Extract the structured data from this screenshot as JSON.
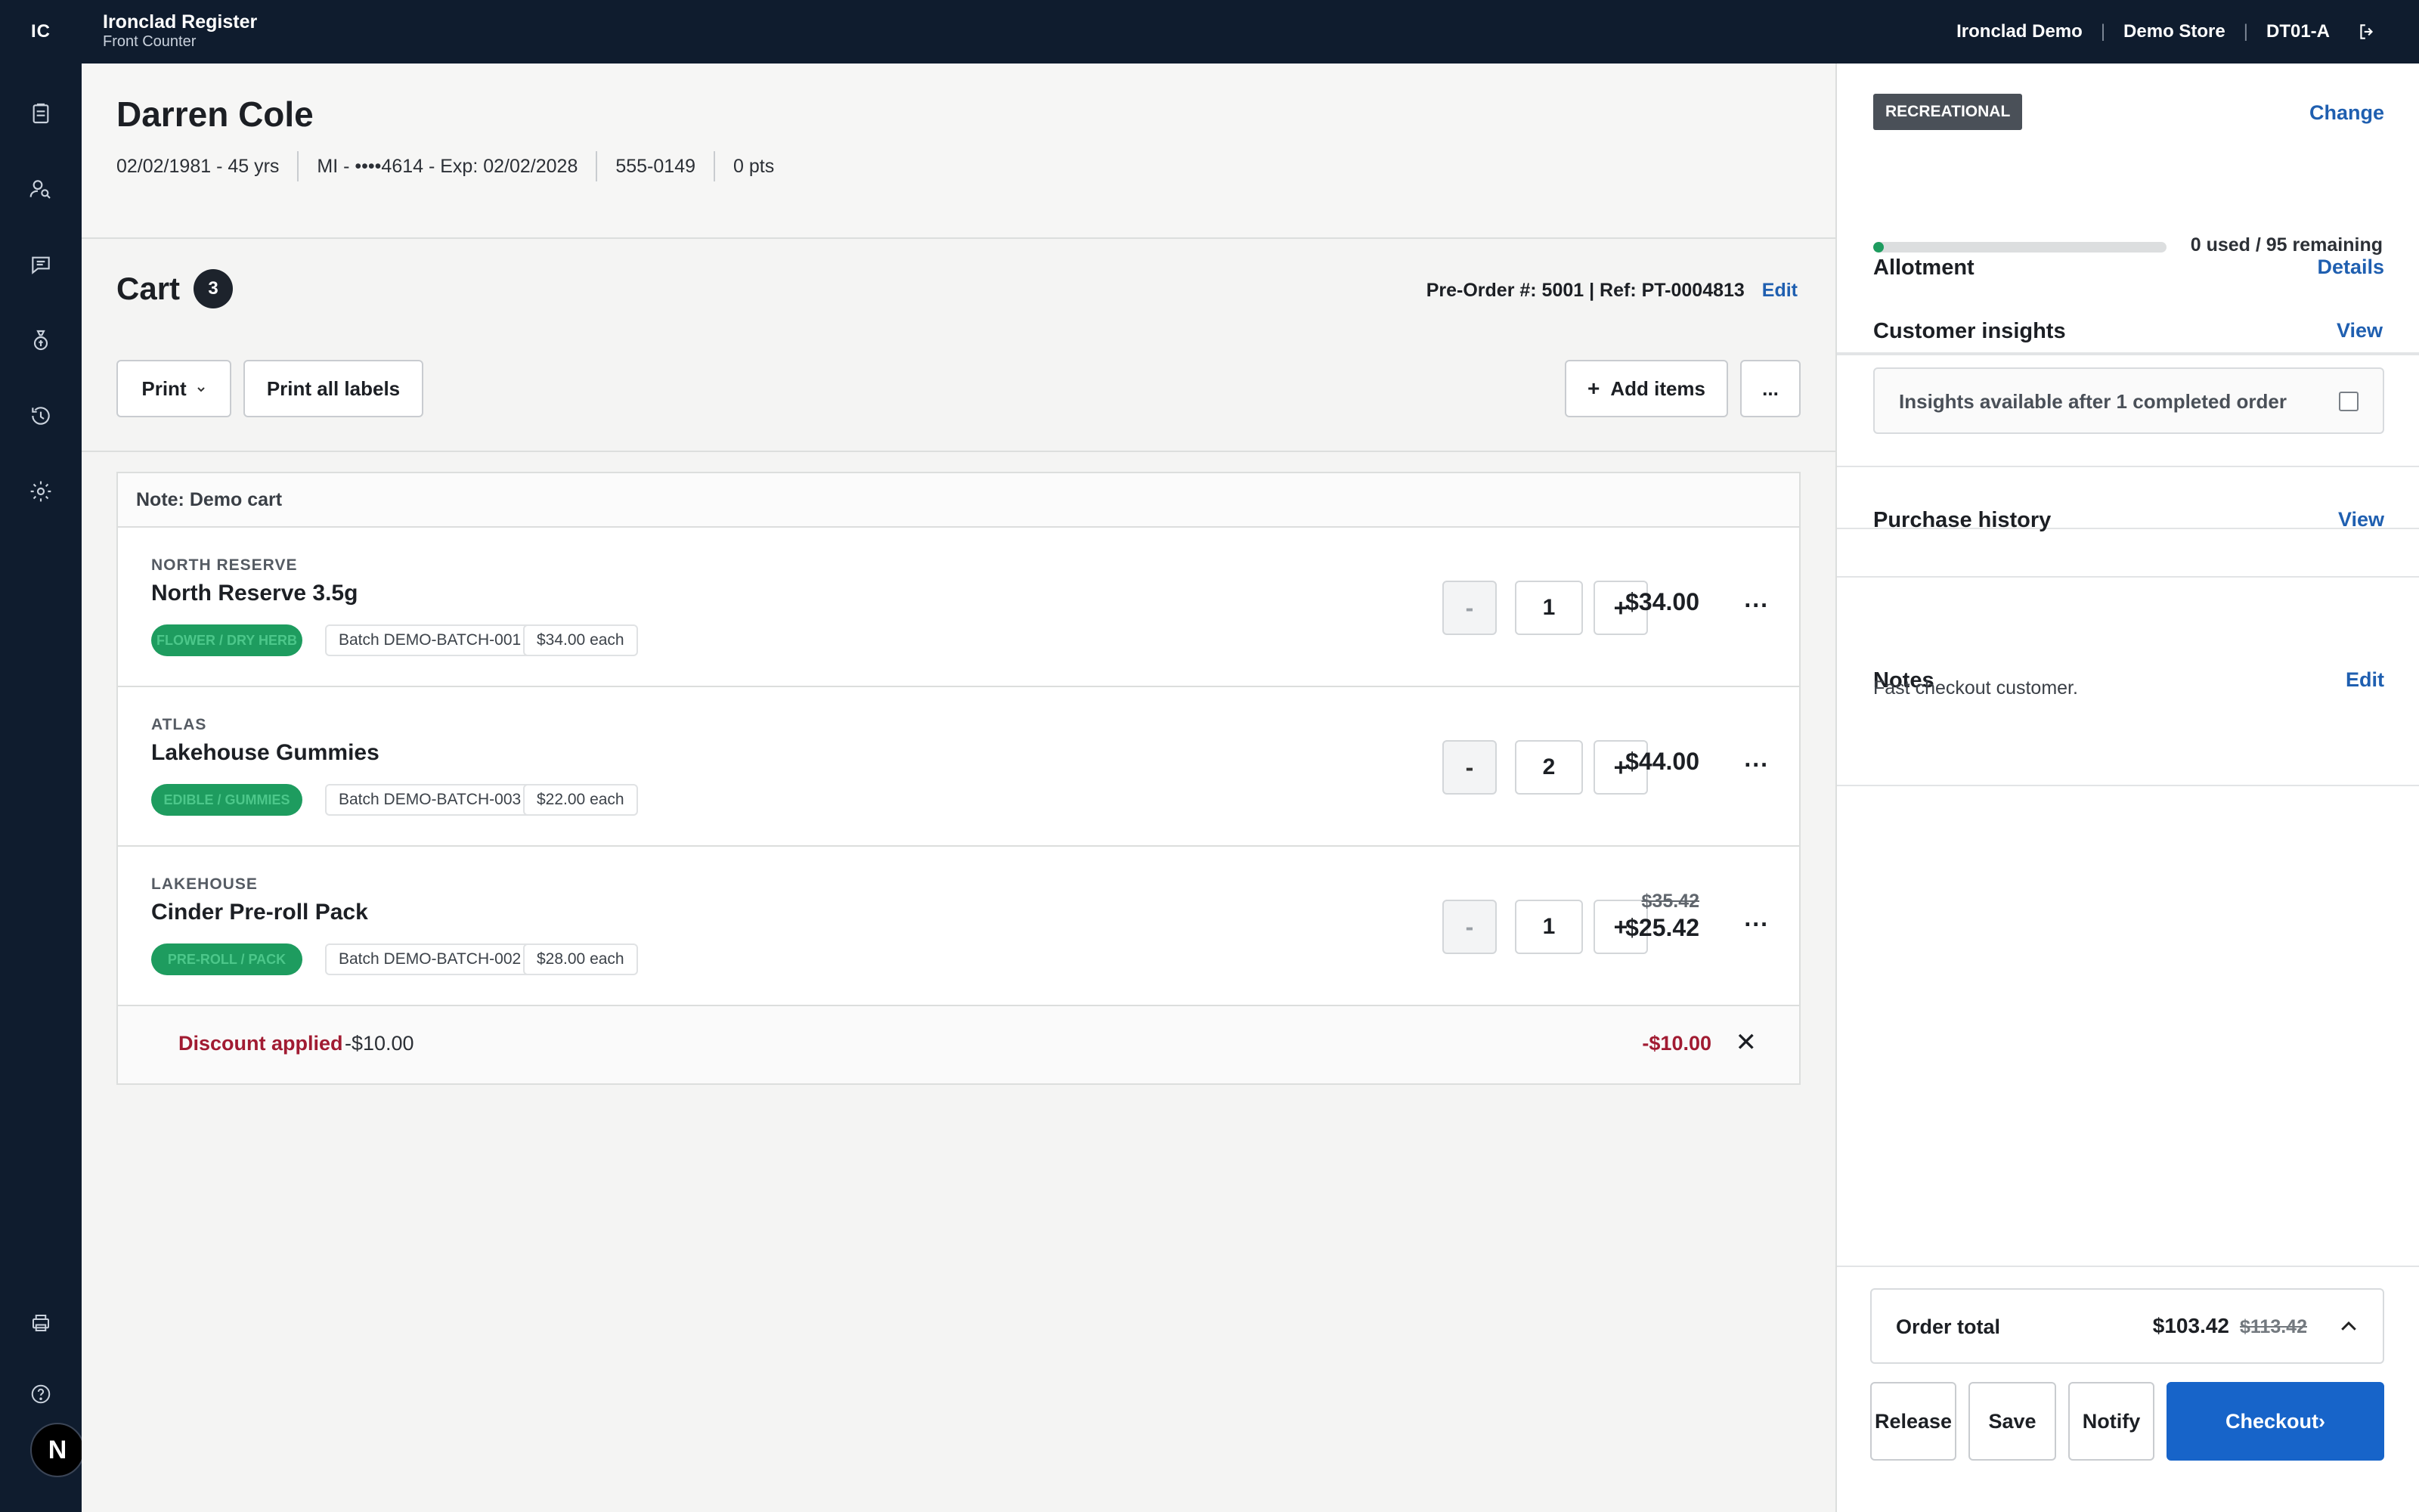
{
  "topbar": {
    "logo": "IC",
    "title": "Ironclad Register",
    "subtitle": "Front Counter",
    "org": "Ironclad Demo",
    "store": "Demo Store",
    "terminal": "DT01-A"
  },
  "rail": {
    "icons": [
      "orders-icon",
      "customer-search-icon",
      "messages-icon",
      "cash-icon",
      "history-icon",
      "settings-icon",
      "printer-icon",
      "help-icon"
    ],
    "badge": "N"
  },
  "customer": {
    "name": "Darren Cole",
    "dob": "02/02/1981 - 45 yrs",
    "id": "MI - ••••4614 - Exp: 02/02/2028",
    "phone": "555-0149",
    "points": "0 pts"
  },
  "cart": {
    "title": "Cart",
    "count": "3",
    "preorder": "Pre-Order #: 5001 | Ref: PT-0004813",
    "edit_label": "Edit",
    "print_label": "Print",
    "print_all_label": "Print all labels",
    "add_items_label": "Add items",
    "more_label": "...",
    "note": "Note: Demo cart",
    "items": [
      {
        "brand": "NORTH RESERVE",
        "name": "North Reserve 3.5g",
        "category": "FLOWER / DRY HERB",
        "batch": "Batch DEMO-BATCH-001",
        "each": "$34.00 each",
        "qty": "1",
        "price": "$34.00",
        "original_price": "",
        "minus_enabled": false
      },
      {
        "brand": "ATLAS",
        "name": "Lakehouse Gummies",
        "category": "EDIBLE / GUMMIES",
        "batch": "Batch DEMO-BATCH-003",
        "each": "$22.00 each",
        "qty": "2",
        "price": "$44.00",
        "original_price": "",
        "minus_enabled": true
      },
      {
        "brand": "LAKEHOUSE",
        "name": "Cinder Pre-roll Pack",
        "category": "PRE-ROLL / PACK",
        "batch": "Batch DEMO-BATCH-002",
        "each": "$28.00 each",
        "qty": "1",
        "price": "$25.42",
        "original_price": "$35.42",
        "minus_enabled": false
      }
    ],
    "discount": {
      "label": "Discount applied",
      "amount": "-$10.00",
      "total": "-$10.00"
    }
  },
  "side": {
    "type_badge": "RECREATIONAL",
    "change_label": "Change",
    "allotment_title": "Allotment",
    "allotment_link": "Details",
    "allotment_text": "0 used / 95 remaining",
    "allotment_used_fraction": 0,
    "insights_title": "Customer insights",
    "insights_link": "View",
    "insights_text": "Insights available after 1 completed order",
    "history_title": "Purchase history",
    "history_link": "View",
    "notes_title": "Notes",
    "notes_link": "Edit",
    "notes_text": "Fast checkout customer.",
    "order_total_label": "Order total",
    "order_total": "$103.42",
    "order_total_original": "$113.42",
    "buttons": {
      "release": "Release",
      "save": "Save",
      "notify": "Notify",
      "checkout": "Checkout›"
    }
  },
  "colors": {
    "topbar": "#0f1c2e",
    "accent": "#1764c9",
    "link": "#1f5fb0",
    "pill": "#1e9c5f",
    "discount": "#a11b32"
  }
}
